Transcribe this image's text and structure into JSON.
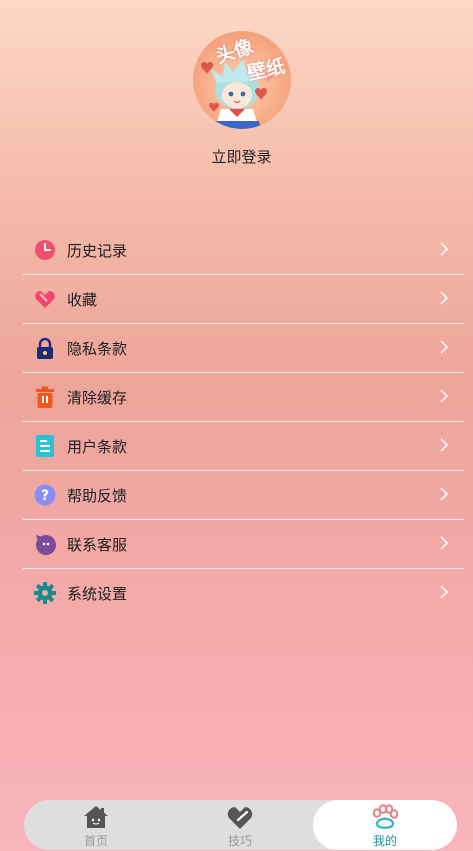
{
  "profile": {
    "avatar_text_1": "头像",
    "avatar_text_2": "壁纸",
    "login_label": "立即登录"
  },
  "menu": {
    "items": [
      {
        "label": "历史记录",
        "icon": "clock-icon",
        "color": "#f0506e"
      },
      {
        "label": "收藏",
        "icon": "heart-icon",
        "color": "#f4446a"
      },
      {
        "label": "隐私条款",
        "icon": "lock-icon",
        "color": "#1e2a78"
      },
      {
        "label": "清除缓存",
        "icon": "trash-icon",
        "color": "#f2561d"
      },
      {
        "label": "用户条款",
        "icon": "document-icon",
        "color": "#2bc0d6"
      },
      {
        "label": "帮助反馈",
        "icon": "help-icon",
        "color": "#8b8cf5"
      },
      {
        "label": "联系客服",
        "icon": "chat-icon",
        "color": "#7d4a9c"
      },
      {
        "label": "系统设置",
        "icon": "gear-icon",
        "color": "#1b8a8a"
      }
    ]
  },
  "tabbar": {
    "tabs": [
      {
        "label": "首页",
        "icon": "home-icon",
        "active": false
      },
      {
        "label": "技巧",
        "icon": "heart-check-icon",
        "active": false
      },
      {
        "label": "我的",
        "icon": "paw-icon",
        "active": true
      }
    ],
    "active_color": "#2a8da2",
    "inactive_color": "#9a9a9a"
  }
}
